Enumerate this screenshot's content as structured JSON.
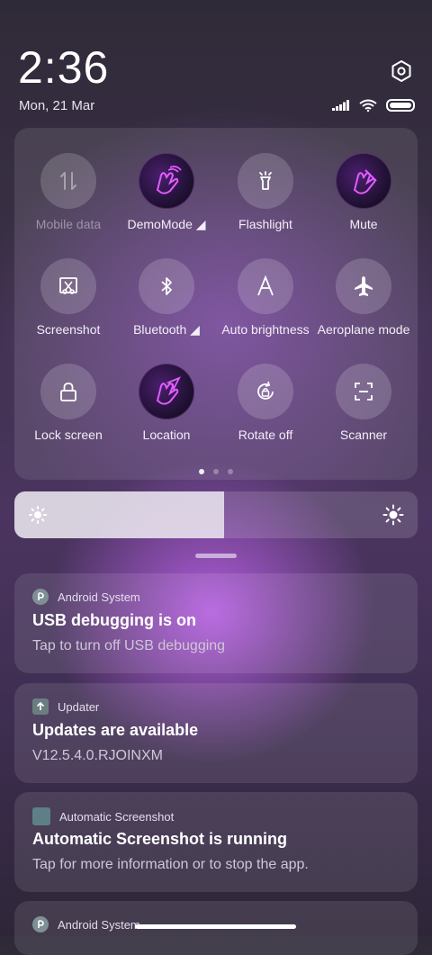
{
  "header": {
    "time": "2:36",
    "date": "Mon, 21 Mar",
    "icons": [
      "settings-icon",
      "signal-icon",
      "wifi-icon",
      "battery-icon"
    ]
  },
  "quick_settings": {
    "tiles": [
      {
        "label": "Mobile data",
        "icon": "mobile-data-icon",
        "state": "disabled"
      },
      {
        "label": "DemoMode ◢",
        "icon": "demomode-icon",
        "state": "on"
      },
      {
        "label": "Flashlight",
        "icon": "flashlight-icon",
        "state": "off"
      },
      {
        "label": "Mute",
        "icon": "mute-icon",
        "state": "on"
      },
      {
        "label": "Screenshot",
        "icon": "screenshot-icon",
        "state": "off"
      },
      {
        "label": "Bluetooth ◢",
        "icon": "bluetooth-icon",
        "state": "off"
      },
      {
        "label": "Auto brightness",
        "icon": "auto-brightness-icon",
        "state": "off"
      },
      {
        "label": "Aeroplane mode",
        "icon": "aeroplane-icon",
        "state": "off"
      },
      {
        "label": "Lock screen",
        "icon": "lock-icon",
        "state": "off"
      },
      {
        "label": "Location",
        "icon": "location-icon",
        "state": "on"
      },
      {
        "label": "Rotate off",
        "icon": "rotate-icon",
        "state": "off"
      },
      {
        "label": "Scanner",
        "icon": "scanner-icon",
        "state": "off"
      }
    ],
    "page_indicator": {
      "pages": 3,
      "current": 1
    }
  },
  "brightness": {
    "level": 0.52
  },
  "notifications": [
    {
      "app": "Android System",
      "title": "USB debugging is on",
      "body": "Tap to turn off USB debugging"
    },
    {
      "app": "Updater",
      "title": "Updates are available",
      "body": "V12.5.4.0.RJOINXM"
    },
    {
      "app": "Automatic Screenshot",
      "title": "Automatic Screenshot is running",
      "body": "Tap for more information or to stop the app."
    },
    {
      "app": "Android System"
    }
  ],
  "colors": {
    "accent_on": "#4a1f6e",
    "tile_glow": "#e25cff"
  }
}
